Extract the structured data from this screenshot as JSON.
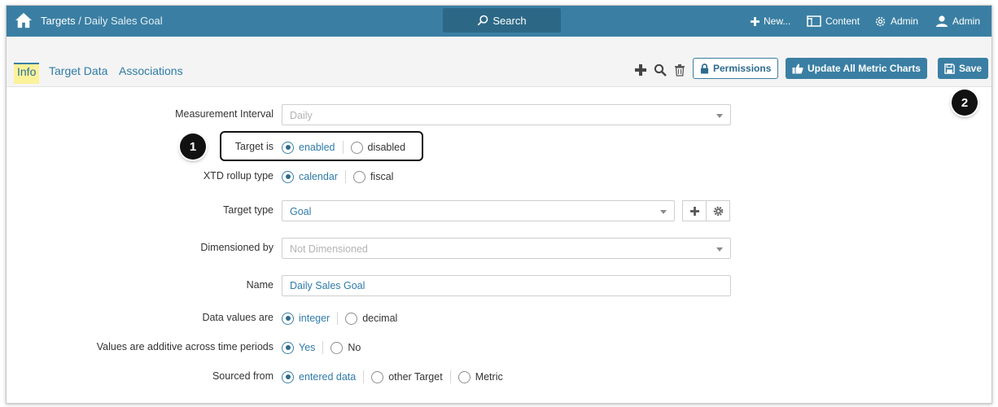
{
  "header": {
    "breadcrumb_root": "Targets",
    "breadcrumb_sep": " / ",
    "breadcrumb_current": "Daily Sales Goal",
    "search_label": "Search",
    "new_label": "New...",
    "content_label": "Content",
    "admin_label": "Admin",
    "user_label": "Admin"
  },
  "tabs": [
    {
      "label": "Info",
      "active": true
    },
    {
      "label": "Target Data",
      "active": false
    },
    {
      "label": "Associations",
      "active": false
    }
  ],
  "toolbar": {
    "permissions_label": "Permissions",
    "update_label": "Update All Metric Charts",
    "save_label": "Save"
  },
  "form": {
    "measurement_interval": {
      "label": "Measurement Interval",
      "value": "Daily"
    },
    "target_is": {
      "label": "Target is",
      "options": [
        "enabled",
        "disabled"
      ],
      "selected": "enabled"
    },
    "xtd_rollup": {
      "label": "XTD rollup type",
      "options": [
        "calendar",
        "fiscal"
      ],
      "selected": "calendar"
    },
    "target_type": {
      "label": "Target type",
      "value": "Goal"
    },
    "dimensioned_by": {
      "label": "Dimensioned by",
      "value": "Not Dimensioned"
    },
    "name": {
      "label": "Name",
      "value": "Daily Sales Goal"
    },
    "data_values": {
      "label": "Data values are",
      "options": [
        "integer",
        "decimal"
      ],
      "selected": "integer"
    },
    "additive": {
      "label": "Values are additive across time periods",
      "options": [
        "Yes",
        "No"
      ],
      "selected": "Yes"
    },
    "sourced_from": {
      "label": "Sourced from",
      "options": [
        "entered data",
        "other Target",
        "Metric"
      ],
      "selected": "entered data"
    }
  },
  "annotations": {
    "step1": "1",
    "step2": "2"
  },
  "colors": {
    "header_bg": "#3a7fa3",
    "accent": "#2e7ba8",
    "active_tab_bg": "#fbf29a"
  }
}
